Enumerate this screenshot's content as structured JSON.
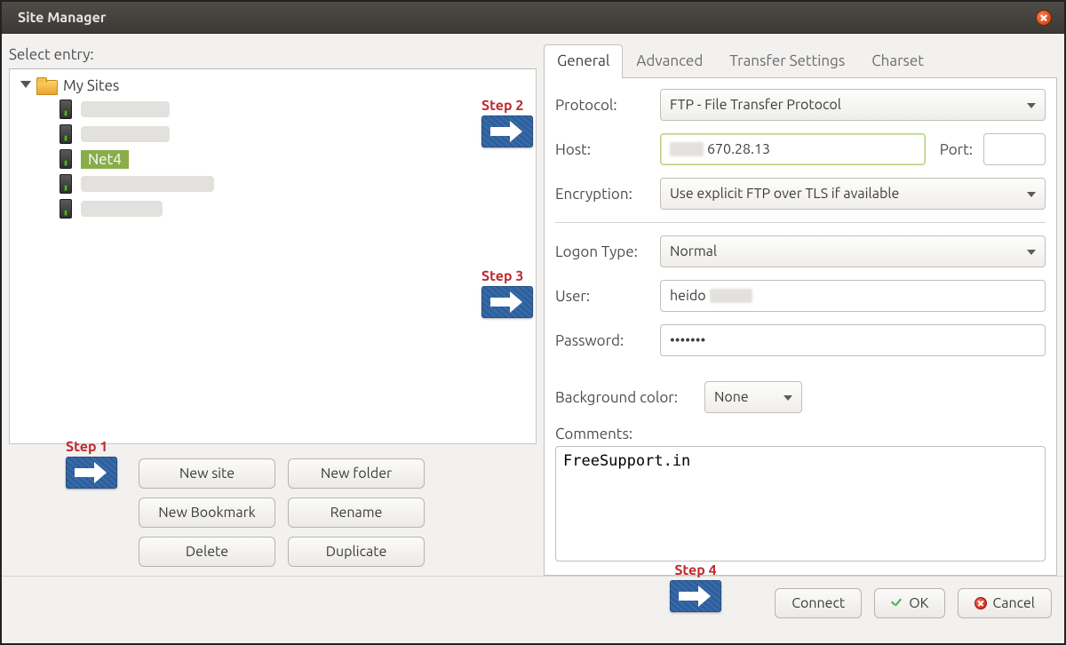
{
  "window": {
    "title": "Site Manager"
  },
  "left": {
    "select_label": "Select entry:",
    "root_folder": "My Sites",
    "selected_site": "Net4",
    "buttons": {
      "new_site": "New site",
      "new_folder": "New folder",
      "new_bookmark": "New Bookmark",
      "rename": "Rename",
      "delete": "Delete",
      "duplicate": "Duplicate"
    }
  },
  "tabs": {
    "general": "General",
    "advanced": "Advanced",
    "transfer": "Transfer Settings",
    "charset": "Charset",
    "active": "general"
  },
  "form": {
    "protocol_label": "Protocol:",
    "protocol_value": "FTP - File Transfer Protocol",
    "host_label": "Host:",
    "host_value": "670.28.13",
    "port_label": "Port:",
    "port_value": "",
    "encryption_label": "Encryption:",
    "encryption_value": "Use explicit FTP over TLS if available",
    "logon_label": "Logon Type:",
    "logon_value": "Normal",
    "user_label": "User:",
    "user_value": "heido",
    "password_label": "Password:",
    "password_value": "•••••••",
    "bgcolor_label": "Background color:",
    "bgcolor_value": "None",
    "comments_label": "Comments:",
    "comments_value": "FreeSupport.in"
  },
  "footer": {
    "connect": "Connect",
    "ok": "OK",
    "cancel": "Cancel"
  },
  "steps": {
    "s1": "Step 1",
    "s2": "Step 2",
    "s3": "Step 3",
    "s4": "Step 4"
  }
}
